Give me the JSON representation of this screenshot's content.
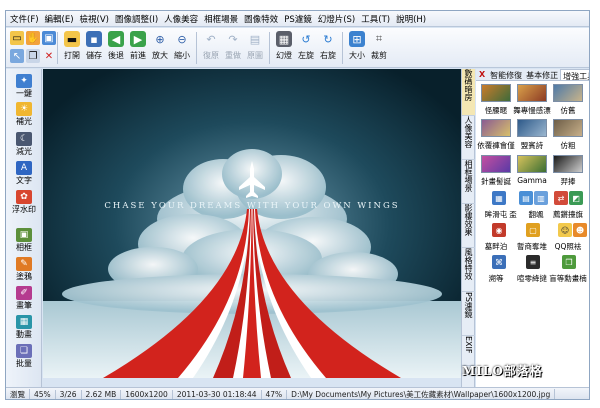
{
  "menu": [
    "文件(F)",
    "編輯(E)",
    "檢視(V)",
    "圖像調整(I)",
    "人像美容",
    "相框場景",
    "圖像特效",
    "PS濾鏡",
    "幻燈片(S)",
    "工具(T)",
    "說明(H)"
  ],
  "toolbar": {
    "open": "打開",
    "save": "儲存",
    "back": "後退",
    "forward": "前進",
    "zoom_in": "放大",
    "zoom_out": "縮小",
    "undo": "復原",
    "redo": "重做",
    "original": "原圖",
    "slideshow": "幻燈",
    "rotate_left": "左旋",
    "rotate_right": "右旋",
    "resize": "大小",
    "crop": "裁剪"
  },
  "left_tools": [
    "一鍵",
    "補光",
    "減光",
    "文字",
    "浮水印",
    "相框",
    "塗鴉",
    "畫筆",
    "動畫",
    "批量"
  ],
  "photo": {
    "slogan": "Chase Your Dreams With Your Own Wings"
  },
  "vertical_tabs": [
    "數碼暗房",
    "人像美容",
    "相框場景",
    "影樓效果",
    "風格特效",
    "PS濾鏡",
    "EXIF"
  ],
  "right_panel": {
    "close": "X",
    "tabs": [
      "智能修復",
      "基本修正",
      "增強工具"
    ],
    "effects_row1": [
      "怪腰暱",
      "舞專慢感漂",
      "仿舊"
    ],
    "effects_row2": [
      "依覆褲會僅",
      "盟賓詩",
      "仿粗"
    ],
    "effects_row3": [
      "針畫髻誕",
      "Gamma",
      "羿捧"
    ],
    "effects_row4": [
      "眸滑屯",
      "盃",
      "翻颯",
      "薦鏘擡旗"
    ],
    "effects_row5": [
      "墓畔泊",
      "暫商奪堆",
      "QQ照袪"
    ],
    "effects_row6": [
      "溯等",
      "喧零絳撻",
      "盲等勳畫楠"
    ]
  },
  "status": {
    "mode": "瀏覽",
    "zoom_label": "45%",
    "index": "3/26",
    "file_size": "2.62 MB",
    "dimensions": "1600x1200",
    "datetime": "2011-03-30 01:18:44",
    "percent": "47%",
    "path": "D:\\My Documents\\My Pictures\\美工佐藏素材\\Wallpaper\\1600x1200.jpg"
  },
  "watermark": "MILO部落格",
  "colors": {
    "sky_top": "#0b2330",
    "cloud": "#d7e8ee",
    "runway_red": "#d2231d",
    "accent_tab": "#f4e7b3"
  }
}
